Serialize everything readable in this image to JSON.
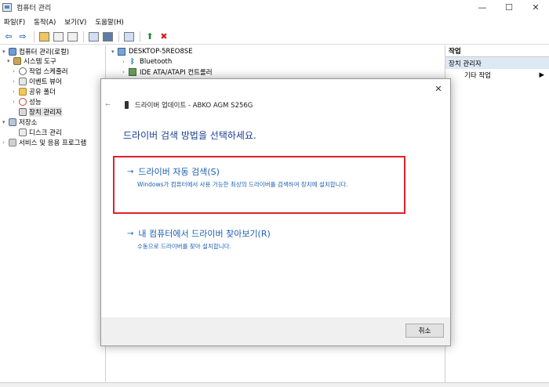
{
  "window": {
    "title": "컴퓨터 관리",
    "minimize": "—",
    "maximize": "☐",
    "close": "✕"
  },
  "menu": [
    "파일(F)",
    "동작(A)",
    "보기(V)",
    "도움말(H)"
  ],
  "left_tree": [
    {
      "label": "컴퓨터 관리(로컬)",
      "icon": "computer-icon",
      "toggle": "▾"
    },
    {
      "label": "시스템 도구",
      "icon": "tools-icon",
      "toggle": "▾"
    },
    {
      "label": "작업 스케줄러",
      "icon": "clock-icon",
      "toggle": "›"
    },
    {
      "label": "이벤트 뷰어",
      "icon": "event-viewer-icon",
      "toggle": "›"
    },
    {
      "label": "공유 폴더",
      "icon": "shared-folder-icon",
      "toggle": "›"
    },
    {
      "label": "성능",
      "icon": "performance-icon",
      "toggle": "›"
    },
    {
      "label": "장치 관리자",
      "icon": "device-manager-icon",
      "toggle": ""
    },
    {
      "label": "저장소",
      "icon": "storage-icon",
      "toggle": "▾"
    },
    {
      "label": "디스크 관리",
      "icon": "disk-icon",
      "toggle": ""
    },
    {
      "label": "서비스 및 응용 프로그램",
      "icon": "services-icon",
      "toggle": "›"
    }
  ],
  "device_tree": {
    "root": "DESKTOP-5REO8SE",
    "items": [
      "Bluetooth",
      "IDE ATA/ATAPI 컨트롤러"
    ]
  },
  "actions": {
    "header": "작업",
    "sub": "장치 관리자",
    "item": "기타 작업",
    "item_arrow": "▶"
  },
  "dialog": {
    "close": "✕",
    "back": "←",
    "header": "드라이버 업데이트 - ABKO AGM S256G",
    "title": "드라이버 검색 방법을 선택하세요.",
    "option1_title": "드라이버 자동 검색(S)",
    "option1_desc": "Windows가 컴퓨터에서 사용 가능한 최상의 드라이버를 검색하여 장치에 설치합니다.",
    "option2_title": "내 컴퓨터에서 드라이버 찾아보기(R)",
    "option2_desc": "수동으로 드라이버를 찾아 설치합니다.",
    "arrow": "→",
    "cancel": "취소"
  },
  "colors": {
    "link_blue": "#1a5fb4",
    "title_blue": "#1c3f94",
    "highlight_red": "#e0202a",
    "action_selected": "#dde8f5"
  }
}
